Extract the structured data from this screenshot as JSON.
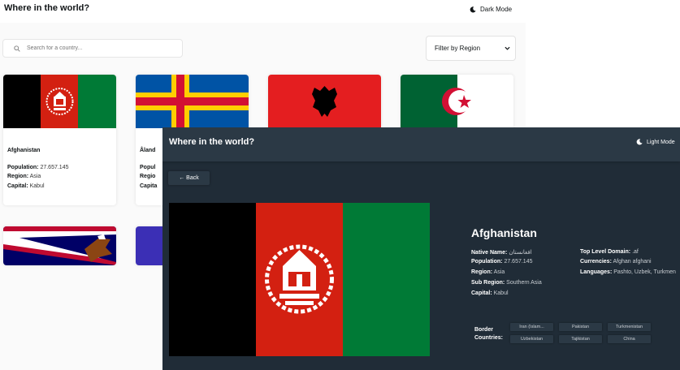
{
  "light_app": {
    "title": "Where in the world?",
    "mode_toggle_label": "Dark Mode",
    "search": {
      "placeholder": "Search for a country...",
      "value": ""
    },
    "filter": {
      "selected": "Filter by Region"
    },
    "cards": [
      {
        "name": "Afghanistan",
        "population_label": "Population:",
        "population": "27.657.145",
        "region_label": "Region:",
        "region": "Asia",
        "capital_label": "Capital:",
        "capital": "Kabul"
      },
      {
        "name": "Åland",
        "population_label": "Popul",
        "region_label": "Regio",
        "capital_label": "Capita"
      },
      {
        "name": ""
      },
      {
        "name": ""
      }
    ]
  },
  "dark_app": {
    "title": "Where in the world?",
    "mode_toggle_label": "Light Mode",
    "back_label": "← Back",
    "country": {
      "name": "Afghanistan",
      "native_name_label": "Native Name:",
      "native_name": "افغانستان",
      "population_label": "Population:",
      "population": "27.657.145",
      "region_label": "Region:",
      "region": "Asia",
      "sub_region_label": "Sub Region:",
      "sub_region": "Southern Asia",
      "capital_label": "Capital:",
      "capital": "Kabul",
      "tld_label": "Top Level Domain:",
      "tld": ".af",
      "currencies_label": "Currencies:",
      "currencies": "Afghan afghani",
      "languages_label": "Languages:",
      "languages": "Pashto, Uzbek, Turkmen",
      "border_label_1": "Border",
      "border_label_2": "Countries:",
      "border_countries": [
        "Iran (Islam...",
        "Pakistan",
        "Turkmenistan",
        "Uzbekistan",
        "Tajikistan",
        "China"
      ]
    }
  },
  "colors": {
    "light_bg": "#fafafa",
    "dark_bg": "#202c37",
    "dark_elements": "#2b3945",
    "text_light_mode": "#111517"
  },
  "icons": {
    "moon": "moon-icon",
    "search": "search-icon",
    "chevron": "chevron-down-icon",
    "arrow_back": "arrow-left-icon"
  }
}
